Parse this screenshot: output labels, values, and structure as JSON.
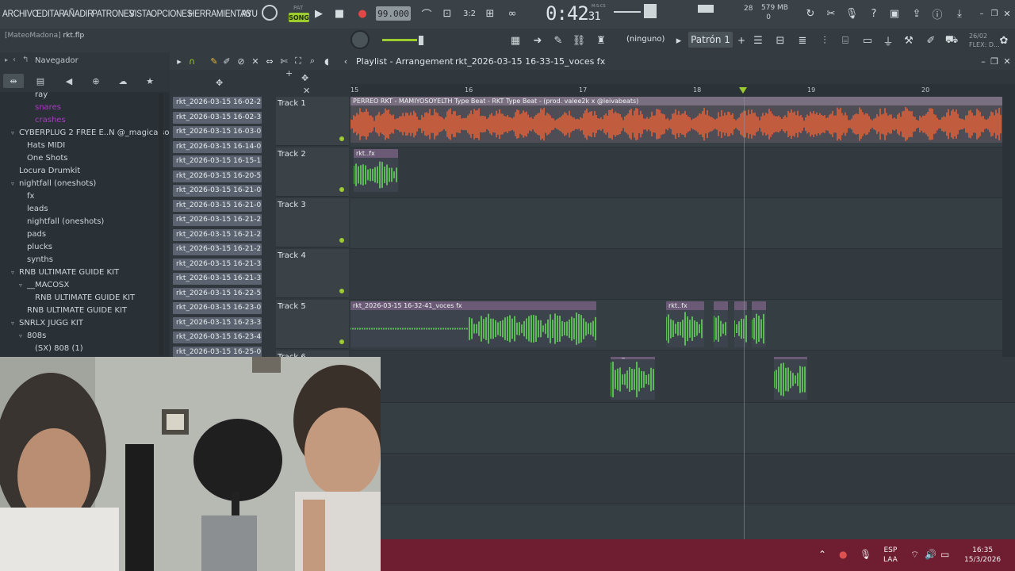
{
  "menu": [
    "ARCHIVO",
    "EDITAR",
    "AÑADIR",
    "PATRONES",
    "VISTA",
    "OPCIONES",
    "HERRAMIENTAS",
    "AYU"
  ],
  "transport": {
    "pat_label": "PAT",
    "song_label": "SONG",
    "tempo": "99.000",
    "time_main": "0:42",
    "time_sub": "31",
    "time_unit": "M:S:CS",
    "cpu": "28",
    "memory": "579 MB",
    "voices": "0"
  },
  "toolbar2": {
    "hint_user": "[MateoMadona]",
    "hint_file": "rkt.flp",
    "snap_label": "(ninguno)",
    "pattern_label": "Patrón 1",
    "date_short": "26/02",
    "flex_label": "FLEX: D..."
  },
  "browser": {
    "title": "Navegador",
    "items": [
      {
        "label": "ray",
        "indent": 3,
        "purple": false
      },
      {
        "label": "snares",
        "indent": 3,
        "purple": true
      },
      {
        "label": "crashes",
        "indent": 3,
        "purple": true
      },
      {
        "label": "CYBERPLUG 2 FREE E..N @_magicalsounds",
        "indent": 1,
        "purple": false,
        "fold": true
      },
      {
        "label": "Hats MIDI",
        "indent": 2,
        "purple": false
      },
      {
        "label": "One Shots",
        "indent": 2,
        "purple": false
      },
      {
        "label": "Locura Drumkit",
        "indent": 1,
        "purple": false
      },
      {
        "label": "nightfall (oneshots)",
        "indent": 1,
        "purple": false,
        "fold": true
      },
      {
        "label": "fx",
        "indent": 2,
        "purple": false
      },
      {
        "label": "leads",
        "indent": 2,
        "purple": false
      },
      {
        "label": "nightfall (oneshots)",
        "indent": 2,
        "purple": false
      },
      {
        "label": "pads",
        "indent": 2,
        "purple": false
      },
      {
        "label": "plucks",
        "indent": 2,
        "purple": false
      },
      {
        "label": "synths",
        "indent": 2,
        "purple": false
      },
      {
        "label": "RNB ULTIMATE GUIDE KIT",
        "indent": 1,
        "purple": false,
        "fold": true
      },
      {
        "label": "__MACOSX",
        "indent": 2,
        "purple": false,
        "fold": true
      },
      {
        "label": "RNB ULTIMATE GUIDE KIT",
        "indent": 3,
        "purple": false
      },
      {
        "label": "RNB ULTIMATE GUIDE KIT",
        "indent": 2,
        "purple": false
      },
      {
        "label": "SNRLX JUGG KIT",
        "indent": 1,
        "purple": false,
        "fold": true
      },
      {
        "label": "808s",
        "indent": 2,
        "purple": false,
        "fold": true
      },
      {
        "label": "(SX) 808 (1)",
        "indent": 3,
        "purple": false
      }
    ]
  },
  "playlist": {
    "title": "Playlist - Arrangement",
    "pattern_path": "rkt_2026-03-15 16-33-15_voces fx",
    "bars": [
      "15",
      "16",
      "17",
      "18",
      "19",
      "20"
    ],
    "clip_names": [
      "rkt_2026-03-15 16-02-2...",
      "rkt_2026-03-15 16-02-3...",
      "rkt_2026-03-15 16-03-0...",
      "rkt_2026-03-15 16-14-0...",
      "rkt_2026-03-15 16-15-1...",
      "rkt_2026-03-15 16-20-5...",
      "rkt_2026-03-15 16-21-0...",
      "rkt_2026-03-15 16-21-0...",
      "rkt_2026-03-15 16-21-2...",
      "rkt_2026-03-15 16-21-2...",
      "rkt_2026-03-15 16-21-2...",
      "rkt_2026-03-15 16-21-3...",
      "rkt_2026-03-15 16-21-3...",
      "rkt_2026-03-15 16-22-5...",
      "rkt_2026-03-15 16-23-0...",
      "rkt_2026-03-15 16-23-3...",
      "rkt_2026-03-15 16-23-4...",
      "rkt_2026-03-15 16-25-0..."
    ],
    "tracks": [
      "Track 1",
      "Track 2",
      "Track 3",
      "Track 4",
      "Track 5",
      "Track 6"
    ],
    "clips": {
      "main": "PERREO RKT - MAMIYOSOYELTH Type Beat - RKT Type Beat - (prod. valee2k x @leivabeats)",
      "t2": "rkt..fx",
      "t5a": "rkt_2026-03-15 16-32-41_voces fx",
      "t5b": "rkt..fx",
      "t6a": "rkt_2..es fx",
      "t6b": "rkt..s fx"
    }
  },
  "taskbar": {
    "lang1": "ESP",
    "lang2": "LAA",
    "time": "16:35",
    "date": "15/3/2026"
  },
  "colors": {
    "accent_green": "#9ccc2e",
    "wave_main": "#e0603a",
    "wave_voice": "#5db85a",
    "taskbar": "#6f1e31"
  }
}
